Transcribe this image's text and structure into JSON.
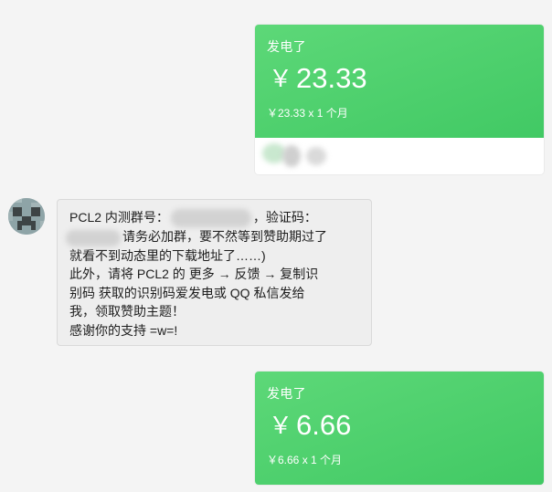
{
  "payments": [
    {
      "title": "发电了",
      "currency_symbol": "￥",
      "amount": "23.33",
      "detail": "￥23.33 x 1 个月"
    },
    {
      "title": "发电了",
      "currency_symbol": "￥",
      "amount": "6.66",
      "detail": "￥6.66 x 1 个月"
    }
  ],
  "message": {
    "line1_prefix": "PCL2 内测群号：",
    "line1_suffix": "，验证码：",
    "line2": "请务必加群，要不然等到赞助期过了",
    "line3": "就看不到动态里的下载地址了……)",
    "line4": "此外，请将 PCL2 的 更多 → 反馈 → 复制识",
    "line5": "别码 获取的识别码爱发电或 QQ 私信发给",
    "line6": "我，领取赞助主题！",
    "line7": "感谢你的支持 =w=!"
  },
  "colors": {
    "card_green": "#4fd270",
    "bubble_bg": "#eeeeee",
    "page_bg": "#f4f4f4"
  },
  "icons": {
    "avatar": "creeper-face-icon",
    "currency": "yen-icon"
  }
}
